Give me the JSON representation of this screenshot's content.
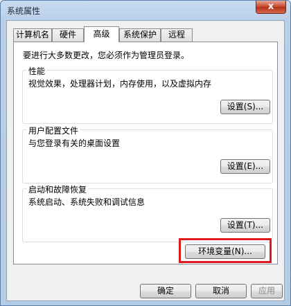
{
  "window": {
    "title": "系统属性",
    "close_label": "x"
  },
  "tabs": [
    {
      "label": "计算机名",
      "active": false
    },
    {
      "label": "硬件",
      "active": false
    },
    {
      "label": "高级",
      "active": true
    },
    {
      "label": "系统保护",
      "active": false
    },
    {
      "label": "远程",
      "active": false
    }
  ],
  "panel": {
    "admin_note": "要进行大多数更改，您必须作为管理员登录。",
    "groups": [
      {
        "title": "性能",
        "description": "视觉效果，处理器计划，内存使用，以及虚拟内存",
        "button": "设置(S)..."
      },
      {
        "title": "用户配置文件",
        "description": "与您登录有关的桌面设置",
        "button": "设置(E)..."
      },
      {
        "title": "启动和故障恢复",
        "description": "系统启动、系统失败和调试信息",
        "button": "设置(T)..."
      }
    ],
    "env_button": "环境变量(N)..."
  },
  "footer": {
    "ok_label": "确定",
    "cancel_label": "取消",
    "apply_label": "应用"
  },
  "accent": {
    "highlight_color": "#e0191b"
  }
}
